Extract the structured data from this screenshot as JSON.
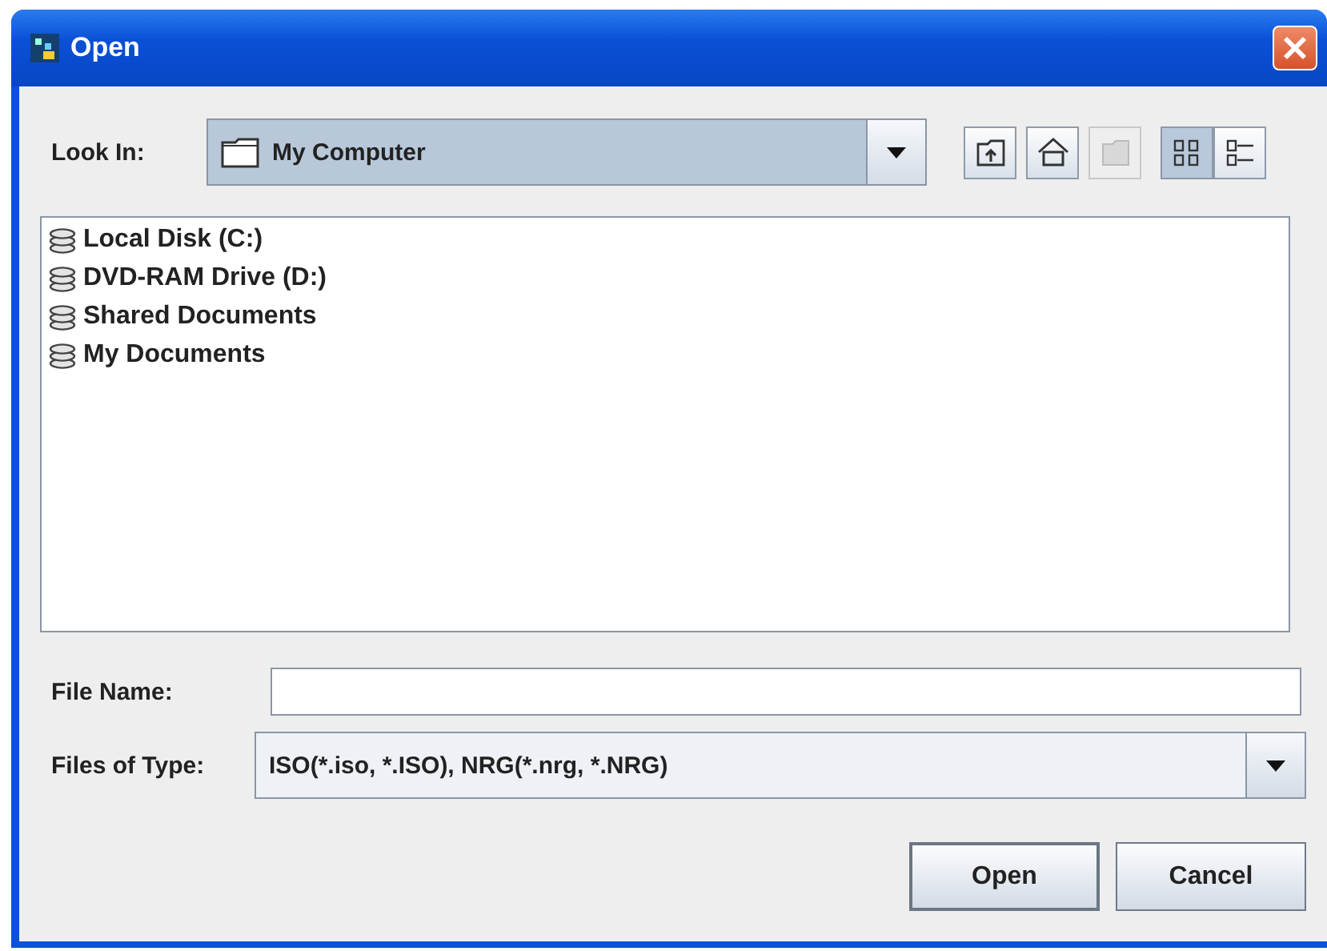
{
  "window": {
    "title": "Open"
  },
  "look_in": {
    "label": "Look In:",
    "value": "My Computer"
  },
  "toolbar": [
    {
      "kind": "up",
      "disabled": false
    },
    {
      "kind": "home",
      "disabled": false
    },
    {
      "kind": "new-folder",
      "disabled": true
    }
  ],
  "view_modes": [
    {
      "kind": "list",
      "selected": true
    },
    {
      "kind": "details",
      "selected": false
    }
  ],
  "files": [
    {
      "name": "Local Disk (C:)"
    },
    {
      "name": "DVD-RAM Drive (D:)"
    },
    {
      "name": "Shared Documents"
    },
    {
      "name": "My Documents"
    }
  ],
  "file_name": {
    "label": "File Name:"
  },
  "file_type": {
    "label": "Files of Type:",
    "value": "ISO(*.iso, *.ISO), NRG(*.nrg, *.NRG)"
  },
  "buttons": [
    {
      "label": "Open"
    },
    {
      "label": "Cancel"
    }
  ]
}
